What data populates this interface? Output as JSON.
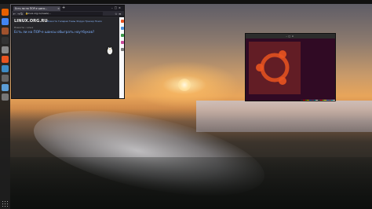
{
  "topbar": {
    "activities": "",
    "clock": "",
    "tray": ""
  },
  "browser": {
    "tab_title": "Есть ли на ПОР-е шанс...",
    "url": "linux.org.ru/news/...",
    "site_logo": "LINUX.ORG.RU",
    "site_nav": "Новости Галерея Темы Форум Трекер Поиск",
    "breadcrumbs": "Новости › Linux",
    "headline": "Есть ли на ПОР-е шансы обыграть ноутбуков?",
    "meta": "",
    "meta2": "",
    "article": "",
    "thumb_caption": ""
  },
  "terminal": {
    "title": "",
    "prompt": "",
    "info": [
      {
        "k": "",
        "v": ""
      },
      {
        "k": "",
        "v": ""
      },
      {
        "k": "",
        "v": ""
      },
      {
        "k": "",
        "v": ""
      },
      {
        "k": "",
        "v": ""
      },
      {
        "k": "",
        "v": ""
      },
      {
        "k": "",
        "v": ""
      },
      {
        "k": "",
        "v": ""
      },
      {
        "k": "",
        "v": ""
      },
      {
        "k": "",
        "v": ""
      },
      {
        "k": "",
        "v": ""
      },
      {
        "k": "",
        "v": ""
      },
      {
        "k": "",
        "v": ""
      },
      {
        "k": "",
        "v": ""
      },
      {
        "k": "",
        "v": ""
      },
      {
        "k": "",
        "v": ""
      },
      {
        "k": "",
        "v": ""
      },
      {
        "k": "",
        "v": ""
      }
    ],
    "palette": [
      "#2e3436",
      "#cc0000",
      "#4e9a06",
      "#c4a000",
      "#3465a4",
      "#75507b",
      "#06989a",
      "#d3d7cf",
      "#555753",
      "#ef2929",
      "#8ae234",
      "#fce94f",
      "#729fcf",
      "#ad7fa8",
      "#34e2e2",
      "#eeeeec"
    ]
  },
  "colors": {
    "accent": "#e95420",
    "link": "#7fb1ff",
    "terminal_bg": "#300a24"
  },
  "dock": {
    "icons": [
      {
        "name": "firefox-icon",
        "color": "#e66000"
      },
      {
        "name": "chrome-icon",
        "color": "#4285f4"
      },
      {
        "name": "files-icon",
        "color": "#a0522d"
      },
      {
        "name": "terminal-icon",
        "color": "#333"
      },
      {
        "name": "settings-icon",
        "color": "#888"
      },
      {
        "name": "software-icon",
        "color": "#e95420"
      },
      {
        "name": "text-editor-icon",
        "color": "#3c8ac4"
      },
      {
        "name": "calculator-icon",
        "color": "#666"
      },
      {
        "name": "mail-icon",
        "color": "#5c9dd6"
      },
      {
        "name": "trash-icon",
        "color": "#777"
      }
    ]
  }
}
